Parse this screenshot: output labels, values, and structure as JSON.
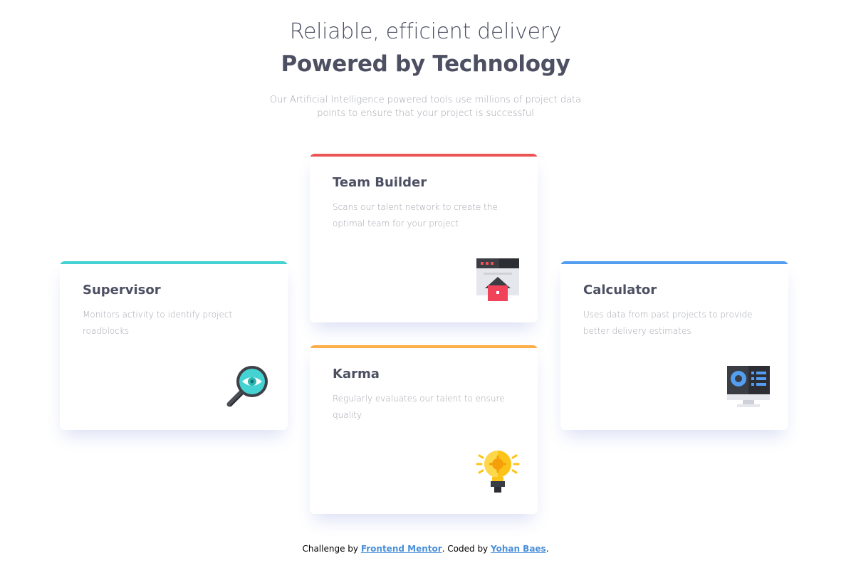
{
  "header": {
    "title_light": "Reliable, efficient delivery",
    "title_bold": "Powered by Technology",
    "lead": "Our Artificial Intelligence powered tools use millions of project data points to ensure that your project is successful"
  },
  "cards": {
    "supervisor": {
      "title": "Supervisor",
      "text": "Monitors activity to identify project roadblocks",
      "accent": "#44d3d2",
      "icon": "magnifier-eye-icon"
    },
    "team": {
      "title": "Team Builder",
      "text": "Scans our talent network to create the optimal team for your project",
      "accent": "#ea5454",
      "icon": "browser-house-icon"
    },
    "karma": {
      "title": "Karma",
      "text": "Regularly evaluates our talent to ensure quality",
      "accent": "#fcae4a",
      "icon": "lightbulb-icon"
    },
    "calculator": {
      "title": "Calculator",
      "text": "Uses data from past projects to provide better delivery estimates",
      "accent": "#549ef2",
      "icon": "monitor-chart-icon"
    }
  },
  "attribution": {
    "prefix": "Challenge by ",
    "link1": "Frontend Mentor",
    "middle": ". Coded by ",
    "link2": "Yohan Baes",
    "suffix": "."
  }
}
